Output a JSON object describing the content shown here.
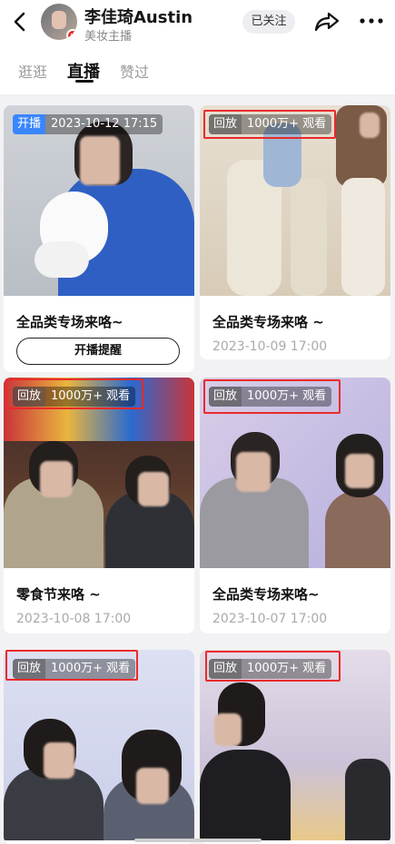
{
  "header": {
    "name": "李佳琦Austin",
    "subtitle": "美妆主播",
    "follow_label": "已关注"
  },
  "tabs": [
    {
      "label": "逛逛",
      "active": false
    },
    {
      "label": "直播",
      "active": true
    },
    {
      "label": "赞过",
      "active": false
    }
  ],
  "cards": [
    {
      "tag_kind": "开播",
      "tag_info": "2023-10-12 17:15",
      "title": "全品类专场来咯~",
      "button": "开播提醒",
      "date": ""
    },
    {
      "tag_kind": "回放",
      "tag_info": "1000万+ 观看",
      "title": "全品类专场来咯 ~",
      "date": "2023-10-09 17:00"
    },
    {
      "tag_kind": "回放",
      "tag_info": "1000万+ 观看",
      "title": "零食节来咯 ~",
      "date": "2023-10-08 17:00"
    },
    {
      "tag_kind": "回放",
      "tag_info": "1000万+ 观看",
      "title": "全品类专场来咯~",
      "date": "2023-10-07 17:00"
    },
    {
      "tag_kind": "回放",
      "tag_info": "1000万+ 观看",
      "title": "",
      "date": ""
    },
    {
      "tag_kind": "回放",
      "tag_info": "1000万+ 观看",
      "title": "",
      "date": ""
    }
  ],
  "colors": {
    "live_tag": "#3a86ff",
    "highlight_box": "#ea2a2a",
    "feed_background": "#f2f2f4"
  },
  "icons": [
    "back-icon",
    "verified-badge-icon",
    "share-icon",
    "more-icon"
  ]
}
